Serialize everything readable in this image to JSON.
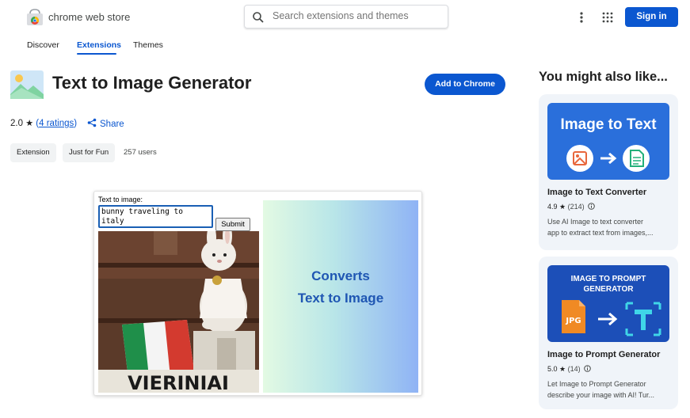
{
  "header": {
    "store_name": "chrome web store",
    "search_placeholder": "Search extensions and themes",
    "sign_in": "Sign in"
  },
  "tabs": [
    {
      "label": "Discover",
      "active": false
    },
    {
      "label": "Extensions",
      "active": true
    },
    {
      "label": "Themes",
      "active": false
    }
  ],
  "extension": {
    "title": "Text to Image Generator",
    "add_button": "Add to Chrome",
    "rating": "2.0",
    "ratings_text": "4 ratings",
    "share": "Share",
    "chips": [
      "Extension",
      "Just for Fun"
    ],
    "users": "257 users"
  },
  "screenshot": {
    "label": "Text to image:",
    "textarea_value": "bunny traveling to italy",
    "submit": "Submit",
    "banner_line1": "Converts",
    "banner_line2": "Text to Image",
    "photo_caption": "VIERINIAI"
  },
  "sidebar": {
    "title": "You might also like...",
    "cards": [
      {
        "image_text": "Image to Text",
        "name": "Image to Text Converter",
        "rating": "4.9",
        "count": "(214)",
        "desc_line1": "Use AI Image to text converter",
        "desc_line2": "app to extract text from images,..."
      },
      {
        "image_text_line1": "IMAGE TO PROMPT",
        "image_text_line2": "GENERATOR",
        "image_badge": "JPG",
        "name": "Image to Prompt Generator",
        "rating": "5.0",
        "count": "(14)",
        "desc_line1": "Let Image to Prompt Generator",
        "desc_line2": "describe your image with AI! Tur..."
      }
    ]
  },
  "colors": {
    "accent": "#0b57d0",
    "card_bg": "#f0f4f9",
    "card1_image": "#2a6fdb",
    "card2_image": "#1c4fb8"
  }
}
